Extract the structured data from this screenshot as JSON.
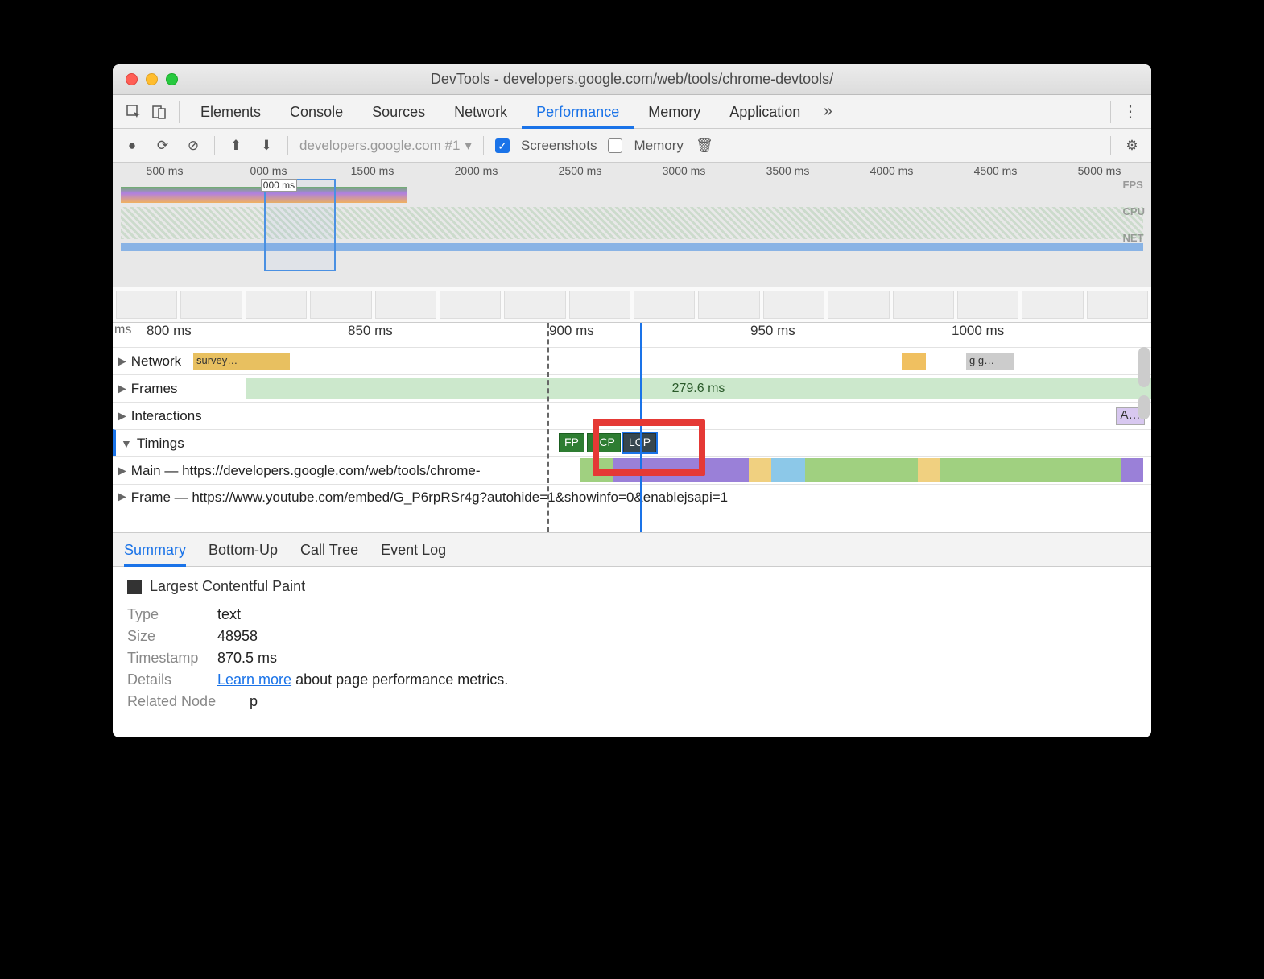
{
  "window": {
    "title": "DevTools - developers.google.com/web/tools/chrome-devtools/"
  },
  "tabs": {
    "items": [
      "Elements",
      "Console",
      "Sources",
      "Network",
      "Performance",
      "Memory",
      "Application"
    ],
    "active_index": 4
  },
  "toolbar": {
    "recording_label": "developers.google.com #1",
    "screenshots_label": "Screenshots",
    "memory_label": "Memory",
    "screenshots_checked": true,
    "memory_checked": false
  },
  "overview": {
    "ticks": [
      "500 ms",
      "000 ms",
      "1500 ms",
      "2000 ms",
      "2500 ms",
      "3000 ms",
      "3500 ms",
      "4000 ms",
      "4500 ms",
      "5000 ms"
    ],
    "rail_labels": [
      "FPS",
      "CPU",
      "NET"
    ]
  },
  "detail": {
    "ruler": [
      "ms",
      "800 ms",
      "850 ms",
      "900 ms",
      "950 ms",
      "1000 ms"
    ],
    "tracks": {
      "network": {
        "label": "Network",
        "item": "survey…",
        "item2": "g g…"
      },
      "frames": {
        "label": "Frames",
        "duration": "279.6 ms"
      },
      "interactions": {
        "label": "Interactions",
        "item": "A…"
      },
      "timings": {
        "label": "Timings",
        "marks": [
          "FP",
          "FCP",
          "LCP"
        ]
      },
      "main": {
        "label": "Main — https://developers.google.com/web/tools/chrome-"
      },
      "frame": {
        "label": "Frame — https://www.youtube.com/embed/G_P6rpRSr4g?autohide=1&showinfo=0&enablejsapi=1"
      }
    }
  },
  "bottom_tabs": {
    "items": [
      "Summary",
      "Bottom-Up",
      "Call Tree",
      "Event Log"
    ],
    "active_index": 0
  },
  "summary": {
    "title": "Largest Contentful Paint",
    "rows": {
      "type": {
        "key": "Type",
        "value": "text"
      },
      "size": {
        "key": "Size",
        "value": "48958"
      },
      "timestamp": {
        "key": "Timestamp",
        "value": "870.5 ms"
      },
      "details": {
        "key": "Details",
        "link": "Learn more",
        "suffix": " about page performance metrics."
      },
      "related": {
        "key": "Related Node",
        "value": "p"
      }
    }
  }
}
